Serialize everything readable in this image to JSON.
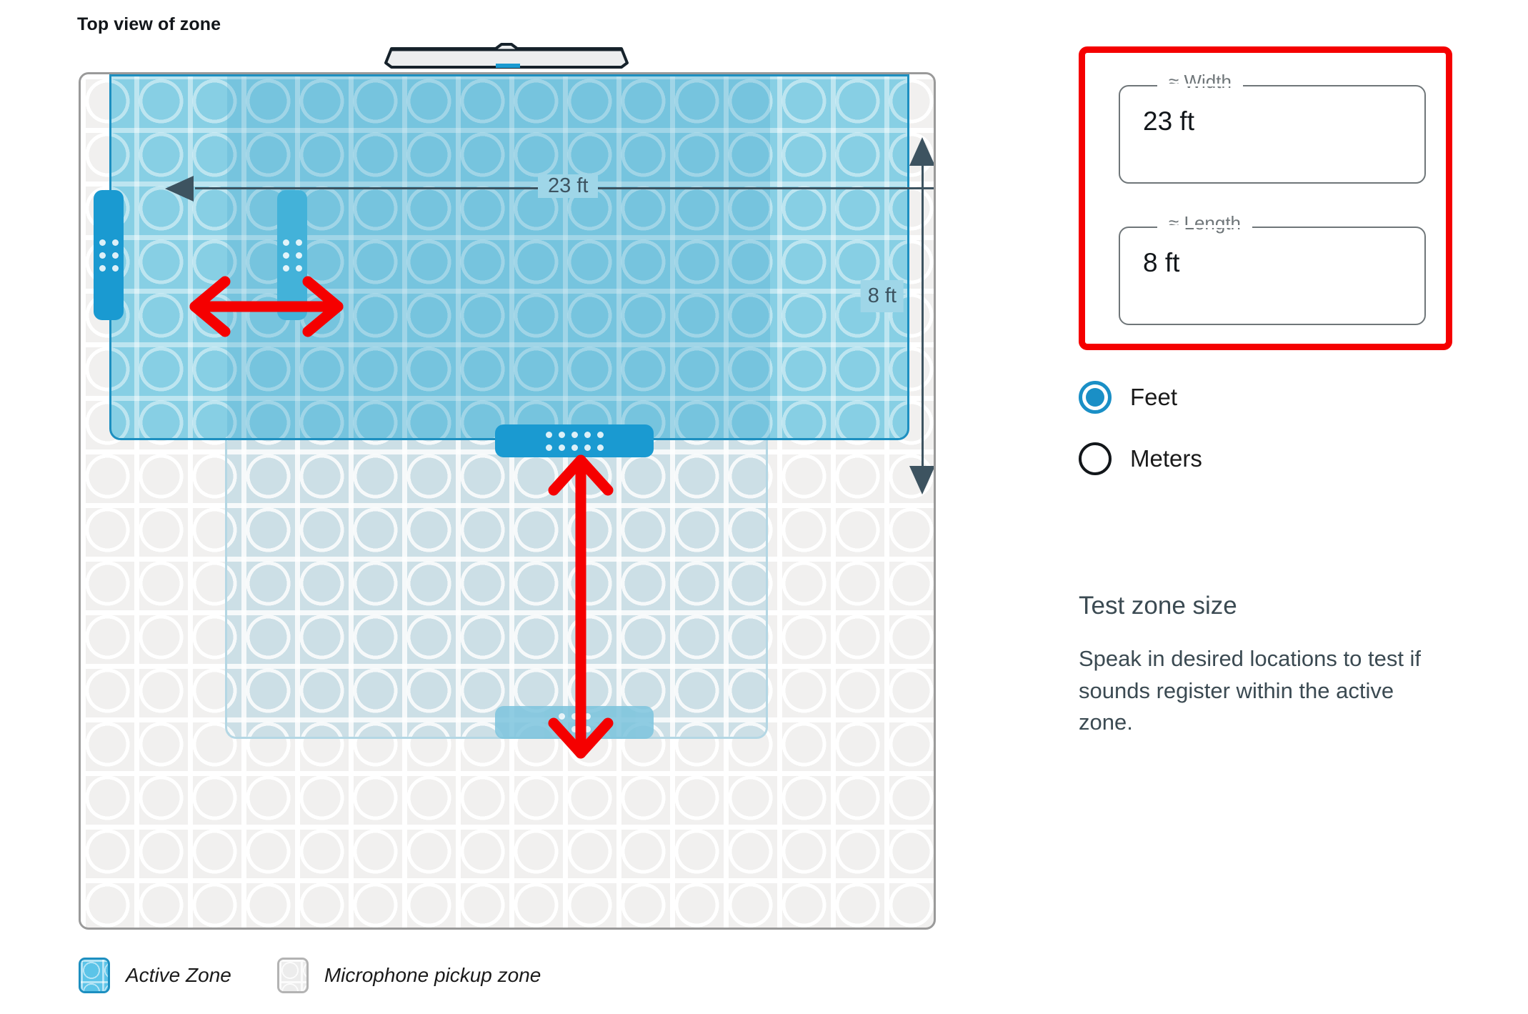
{
  "left_panel": {
    "title": "Top view of zone",
    "device_icon": "soundbar-device-icon",
    "dimensions": {
      "width_label": "23 ft",
      "length_label": "8 ft"
    },
    "annotations": {
      "horizontal_arrow": "red-double-arrow-horizontal",
      "vertical_arrow": "red-double-arrow-vertical"
    },
    "legend": [
      {
        "swatch": "active-zone-swatch",
        "label": "Active Zone"
      },
      {
        "swatch": "microphone-pickup-zone-swatch",
        "label": "Microphone pickup zone"
      }
    ]
  },
  "right_panel": {
    "fields": [
      {
        "label": "≈ Width",
        "value": "23 ft"
      },
      {
        "label": "≈ Length",
        "value": "8 ft"
      }
    ],
    "units": [
      {
        "label": "Feet",
        "selected": true
      },
      {
        "label": "Meters",
        "selected": false
      }
    ],
    "info": {
      "heading": "Test zone size",
      "body": "Speak in desired locations to test if sounds register within the active zone."
    }
  },
  "colors": {
    "active_zone_fill": "#87cfe4",
    "active_zone_border": "#1d8fc0",
    "mic_zone_fill": "#ccdfe6",
    "mic_zone_border": "#b4d7e4",
    "grid_background": "#f1f0ef",
    "handle_blue": "#1a9ad1",
    "annotation_red": "#f50000",
    "accent_blue": "#1a8fc6",
    "text_dark": "#12161a",
    "text_muted": "#3b4a52"
  }
}
